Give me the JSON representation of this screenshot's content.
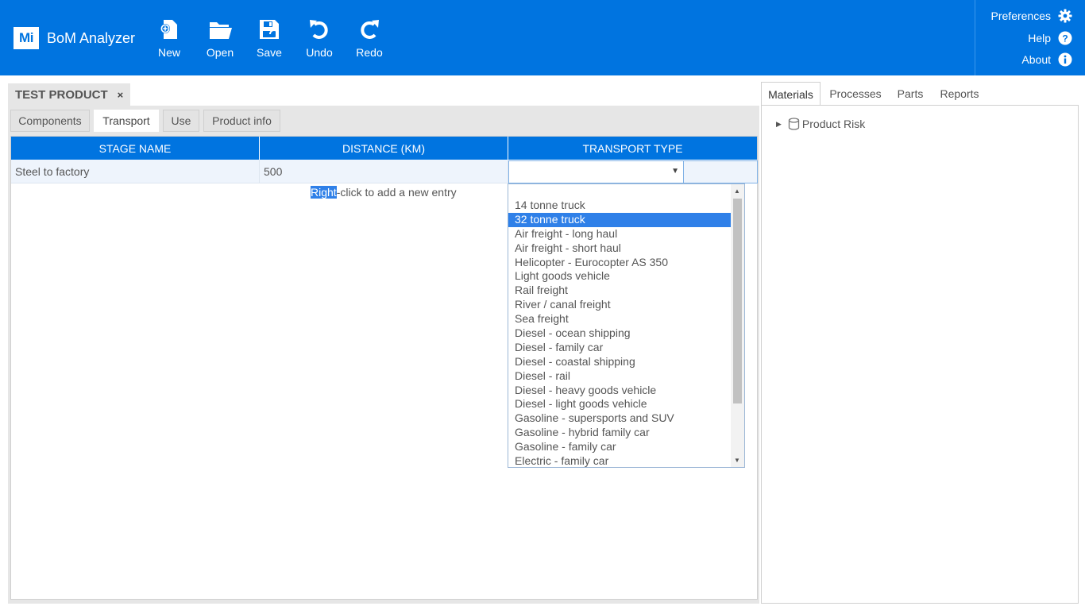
{
  "app": {
    "logo": "Mi",
    "name": "BoM Analyzer"
  },
  "toolbar": {
    "new": "New",
    "open": "Open",
    "save": "Save",
    "undo": "Undo",
    "redo": "Redo"
  },
  "top_right": {
    "preferences": "Preferences",
    "help": "Help",
    "about": "About"
  },
  "document_tab": {
    "title": "TEST PRODUCT",
    "close": "×"
  },
  "subtabs": {
    "components": "Components",
    "transport": "Transport",
    "use": "Use",
    "product_info": "Product info",
    "active": "Transport"
  },
  "grid": {
    "columns": [
      "STAGE NAME",
      "DISTANCE (KM)",
      "TRANSPORT TYPE"
    ],
    "rows": [
      {
        "stage": "Steel to factory",
        "distance": "500",
        "type": ""
      }
    ],
    "hint_highlight": "Right",
    "hint_rest": "-click to add a new entry"
  },
  "dropdown": {
    "selected": "32 tonne truck",
    "options": [
      "14 tonne truck",
      "32 tonne truck",
      "Air freight - long haul",
      "Air freight - short haul",
      "Helicopter - Eurocopter AS 350",
      "Light goods vehicle",
      "Rail freight",
      "River / canal freight",
      "Sea freight",
      "Diesel - ocean shipping",
      "Diesel - family car",
      "Diesel - coastal shipping",
      "Diesel - rail",
      "Diesel - heavy goods vehicle",
      "Diesel - light goods vehicle",
      "Gasoline - supersports and SUV",
      "Gasoline - hybrid family car",
      "Gasoline - family car",
      "Electric - family car"
    ]
  },
  "right_tabs": {
    "materials": "Materials",
    "processes": "Processes",
    "parts": "Parts",
    "reports": "Reports",
    "active": "Materials"
  },
  "tree": {
    "root": "Product Risk",
    "icon": "database-icon"
  },
  "colors": {
    "brand_blue": "#0074e0",
    "selection_blue": "#2f80e8"
  }
}
